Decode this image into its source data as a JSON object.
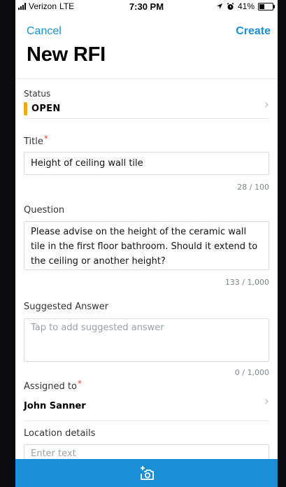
{
  "status_bar": {
    "carrier": "Verizon",
    "network": "LTE",
    "time": "7:30 PM",
    "battery_percent": "41%",
    "battery_level": 0.41
  },
  "nav": {
    "cancel_label": "Cancel",
    "create_label": "Create"
  },
  "page": {
    "title": "New RFI"
  },
  "form": {
    "status": {
      "label": "Status",
      "value": "OPEN",
      "indicator_color": "#f4a61a"
    },
    "title_field": {
      "label": "Title",
      "required_mark": "*",
      "value": "Height of ceiling wall tile",
      "counter": "28 / 100"
    },
    "question": {
      "label": "Question",
      "value": "Please advise on the height of the ceramic wall tile in the first floor bathroom. Should it extend to the ceiling or another height?",
      "counter": "133 / 1,000"
    },
    "suggested_answer": {
      "label": "Suggested Answer",
      "placeholder": "Tap to add suggested answer",
      "counter": "0 / 1,000"
    },
    "assigned_to": {
      "label": "Assigned to",
      "required_mark": "*",
      "value": "John Sanner"
    },
    "location_details": {
      "label": "Location details",
      "placeholder": "Enter text"
    }
  },
  "bottom_bar": {
    "icon": "add-photo-icon"
  },
  "colors": {
    "accent": "#1b8fd6",
    "required": "#e34040",
    "status_open": "#f4a61a"
  }
}
